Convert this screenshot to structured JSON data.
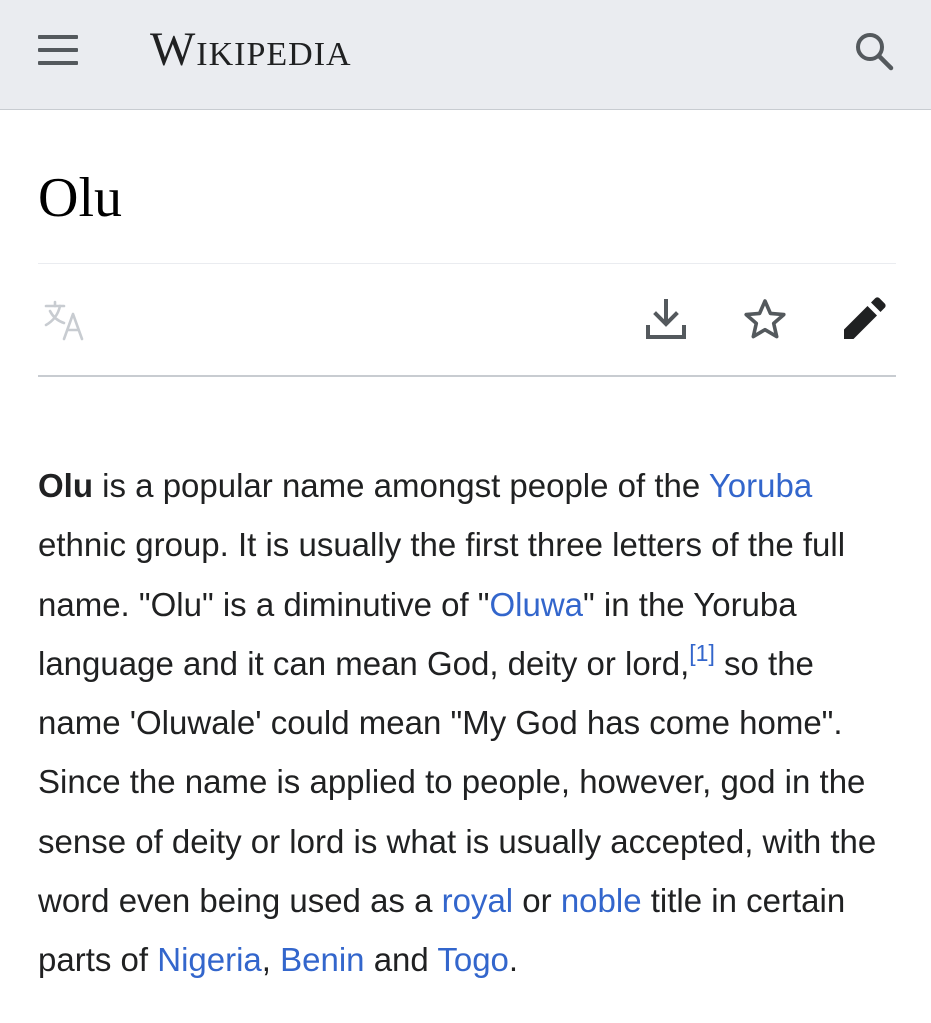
{
  "header": {
    "wordmark": "Wikipedia",
    "menu_icon": "hamburger-menu-icon",
    "search_icon": "search-icon"
  },
  "page": {
    "title": "Olu"
  },
  "actions": [
    {
      "name": "language",
      "icon": "translate-icon"
    },
    {
      "name": "download",
      "icon": "download-icon"
    },
    {
      "name": "watch",
      "icon": "star-outline-icon"
    },
    {
      "name": "edit",
      "icon": "pencil-icon"
    }
  ],
  "article": {
    "p1_bold": "Olu",
    "p1_t1": " is a popular name amongst people of the ",
    "link_yoruba": "Yoruba",
    "p1_t2": " ethnic group. It is usually the first three letters of the full name. \"Olu\" is a diminutive of \"",
    "link_oluwa": "Oluwa",
    "p1_t3": "\" in the Yoruba language and it can mean God, deity or lord,",
    "ref_1": "[1]",
    "p1_t4": " so the name 'Oluwale' could mean \"My God has come home\". Since the name is applied to people, however, god in the sense of deity or lord is what is usually accepted, with the word even being used as a ",
    "link_royal": "royal",
    "p1_t5": " or ",
    "link_noble": "noble",
    "p1_t6": " title in certain parts of ",
    "link_nigeria": "Nigeria",
    "p1_t7": ", ",
    "link_benin": "Benin",
    "p1_t8": " and ",
    "link_togo": "Togo",
    "p1_t9": "."
  },
  "colors": {
    "header_bg": "#eaecf0",
    "link": "#3366cc",
    "icon": "#54595d",
    "icon_disabled": "#c8ccd1",
    "text": "#202122"
  }
}
